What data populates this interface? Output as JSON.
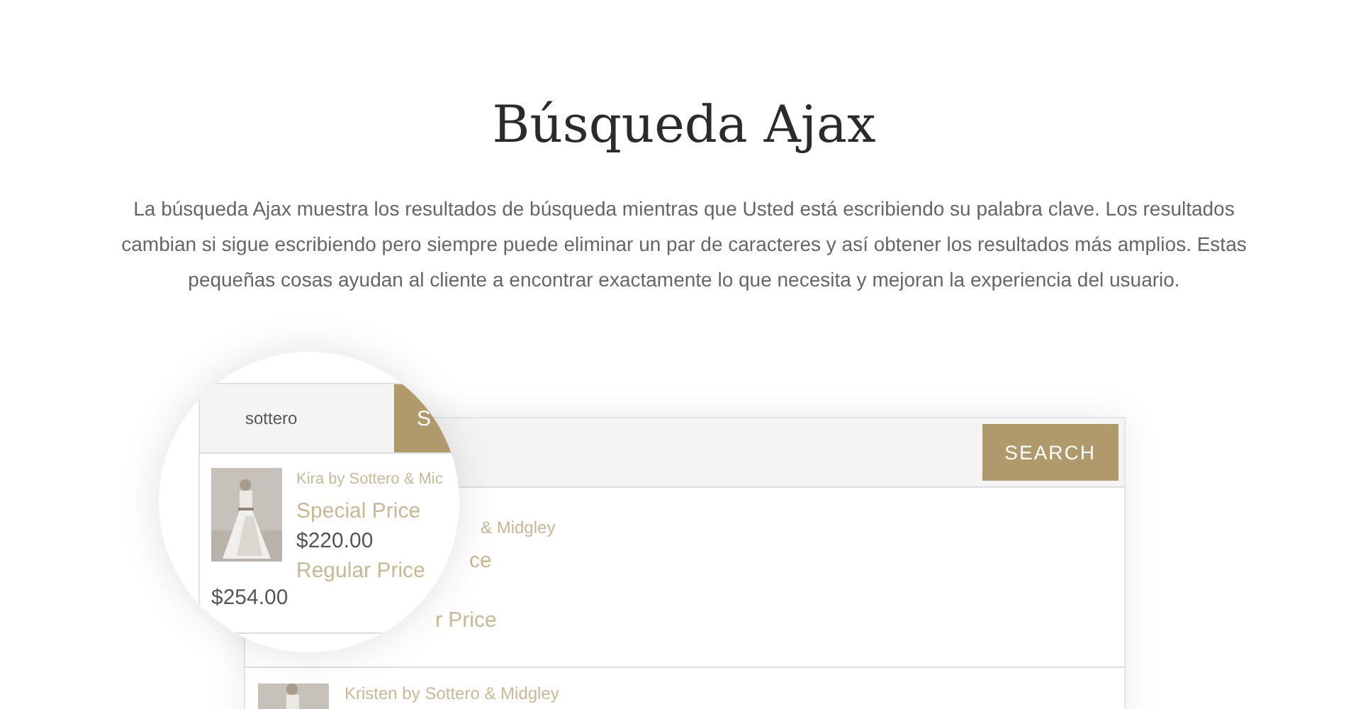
{
  "heading": "Búsqueda Ajax",
  "description": "La búsqueda Ajax muestra los resultados de búsqueda mientras que Usted está escribiendo su palabra clave. Los resultados cambian si sigue escribiendo pero siempre puede eliminar un par de caracteres y así obtener los resultados más amplios. Estas pequeñas cosas ayudan al cliente a encontrar exactamente lo que necesita y mejoran la experiencia del usuario.",
  "widget": {
    "button": "SEARCH",
    "first_result_fragments": [
      {
        "kind": "title",
        "text": "& Midgley"
      },
      {
        "kind": "label",
        "text": "ce"
      },
      {
        "kind": "label",
        "text": "r Price"
      }
    ],
    "second_result": {
      "title": "Kristen by Sottero & Midgley"
    }
  },
  "magnifier": {
    "query": "sottero",
    "button": "S",
    "result": {
      "title": "Kira by Sottero & Mic",
      "special_label": "Special Price",
      "special_price": "$220.00",
      "regular_label": "Regular Price",
      "regular_price": "$254.00"
    }
  }
}
